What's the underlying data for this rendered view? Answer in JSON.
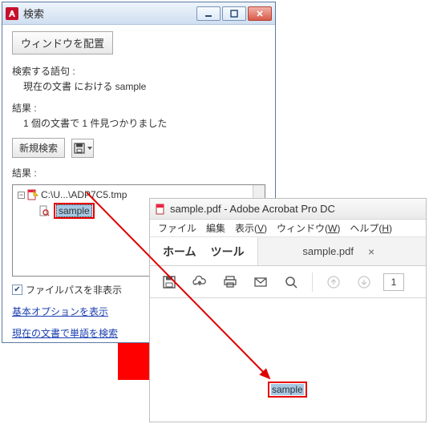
{
  "search_window": {
    "title": "検索",
    "arrange_button": "ウィンドウを配置",
    "query_label": "検索する語句 :",
    "query_value": "現在の文書 における sample",
    "summary_label": "結果 :",
    "summary_value": "1 個の文書で 1 件見つかりました",
    "new_search_button": "新規検索",
    "results_label": "結果 :",
    "tree": {
      "path": "C:\\U...\\ADP7C5.tmp",
      "hit_text": "sample"
    },
    "hide_path_checkbox_label": "ファイルパスを非表示",
    "link_basic_options": "基本オプションを表示",
    "link_search_words": "現在の文書で単語を検索"
  },
  "acrobat_window": {
    "title": "sample.pdf - Adobe Acrobat Pro DC",
    "menus": {
      "file": "ファイル",
      "edit": "編集",
      "view_pre": "表示(",
      "view_u": "V",
      "view_post": ")",
      "window_pre": "ウィンドウ(",
      "window_u": "W",
      "window_post": ")",
      "help_pre": "ヘルプ(",
      "help_u": "H",
      "help_post": ")"
    },
    "home_label": "ホーム",
    "tools_label": "ツール",
    "tab_label": "sample.pdf",
    "page_number": "1",
    "doc_hit": "sample"
  }
}
